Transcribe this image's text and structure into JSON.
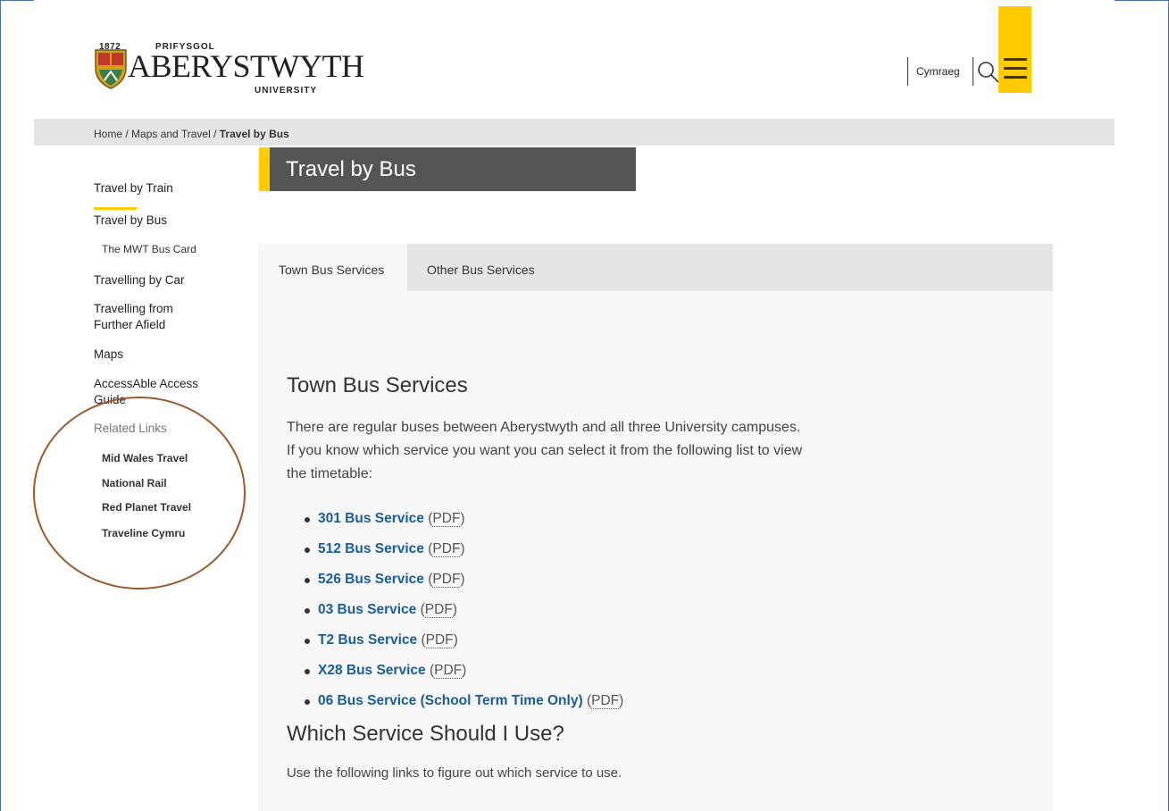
{
  "header": {
    "logo_year": "1872",
    "logo_prifysgol": "PRIFYSGOL",
    "logo_name": "ABERYSTWYTH",
    "logo_university": "UNIVERSITY",
    "language_link": "Cymraeg",
    "accent_color": "#fecc00"
  },
  "breadcrumb": {
    "home": "Home",
    "sep1": " / ",
    "maps": "Maps and Travel",
    "sep2": " / ",
    "current": "Travel by Bus"
  },
  "page_title": "Travel by Bus",
  "sidebar": {
    "items": [
      {
        "label": "Travel by Train"
      },
      {
        "label": "Travel by Bus"
      },
      {
        "label": "The MWT Bus Card"
      },
      {
        "label": "Travelling by Car"
      },
      {
        "label": "Travelling from Further Afield"
      },
      {
        "label": "Maps"
      },
      {
        "label": "AccessAble Access Guide"
      }
    ],
    "related_label": "Related Links",
    "related": [
      {
        "label": "Mid Wales Travel"
      },
      {
        "label": "National Rail"
      },
      {
        "label": "Red Planet Travel"
      },
      {
        "label": "Traveline Cymru"
      }
    ]
  },
  "tabs": [
    {
      "label": "Town Bus Services"
    },
    {
      "label": "Other Bus Services"
    }
  ],
  "main": {
    "heading": "Town Bus Services",
    "intro": "There are regular buses between Aberystwyth and all three University campuses. If you know which service you want you can select it from the following list to view the timetable:",
    "services": [
      {
        "label": "301 Bus Service",
        "pdf": "PDF"
      },
      {
        "label": "512 Bus Service",
        "pdf": "PDF"
      },
      {
        "label": "526 Bus Service",
        "pdf": "PDF"
      },
      {
        "label": "03 Bus Service",
        "pdf": "PDF"
      },
      {
        "label": "T2 Bus Service",
        "pdf": "PDF"
      },
      {
        "label": "X28 Bus Service",
        "pdf": "PDF"
      },
      {
        "label": "06 Bus Service (School Term Time Only)",
        "pdf": "PDF"
      }
    ],
    "heading2": "Which Service Should I Use?",
    "footer_text": "Use the following links to figure out which service to use."
  }
}
